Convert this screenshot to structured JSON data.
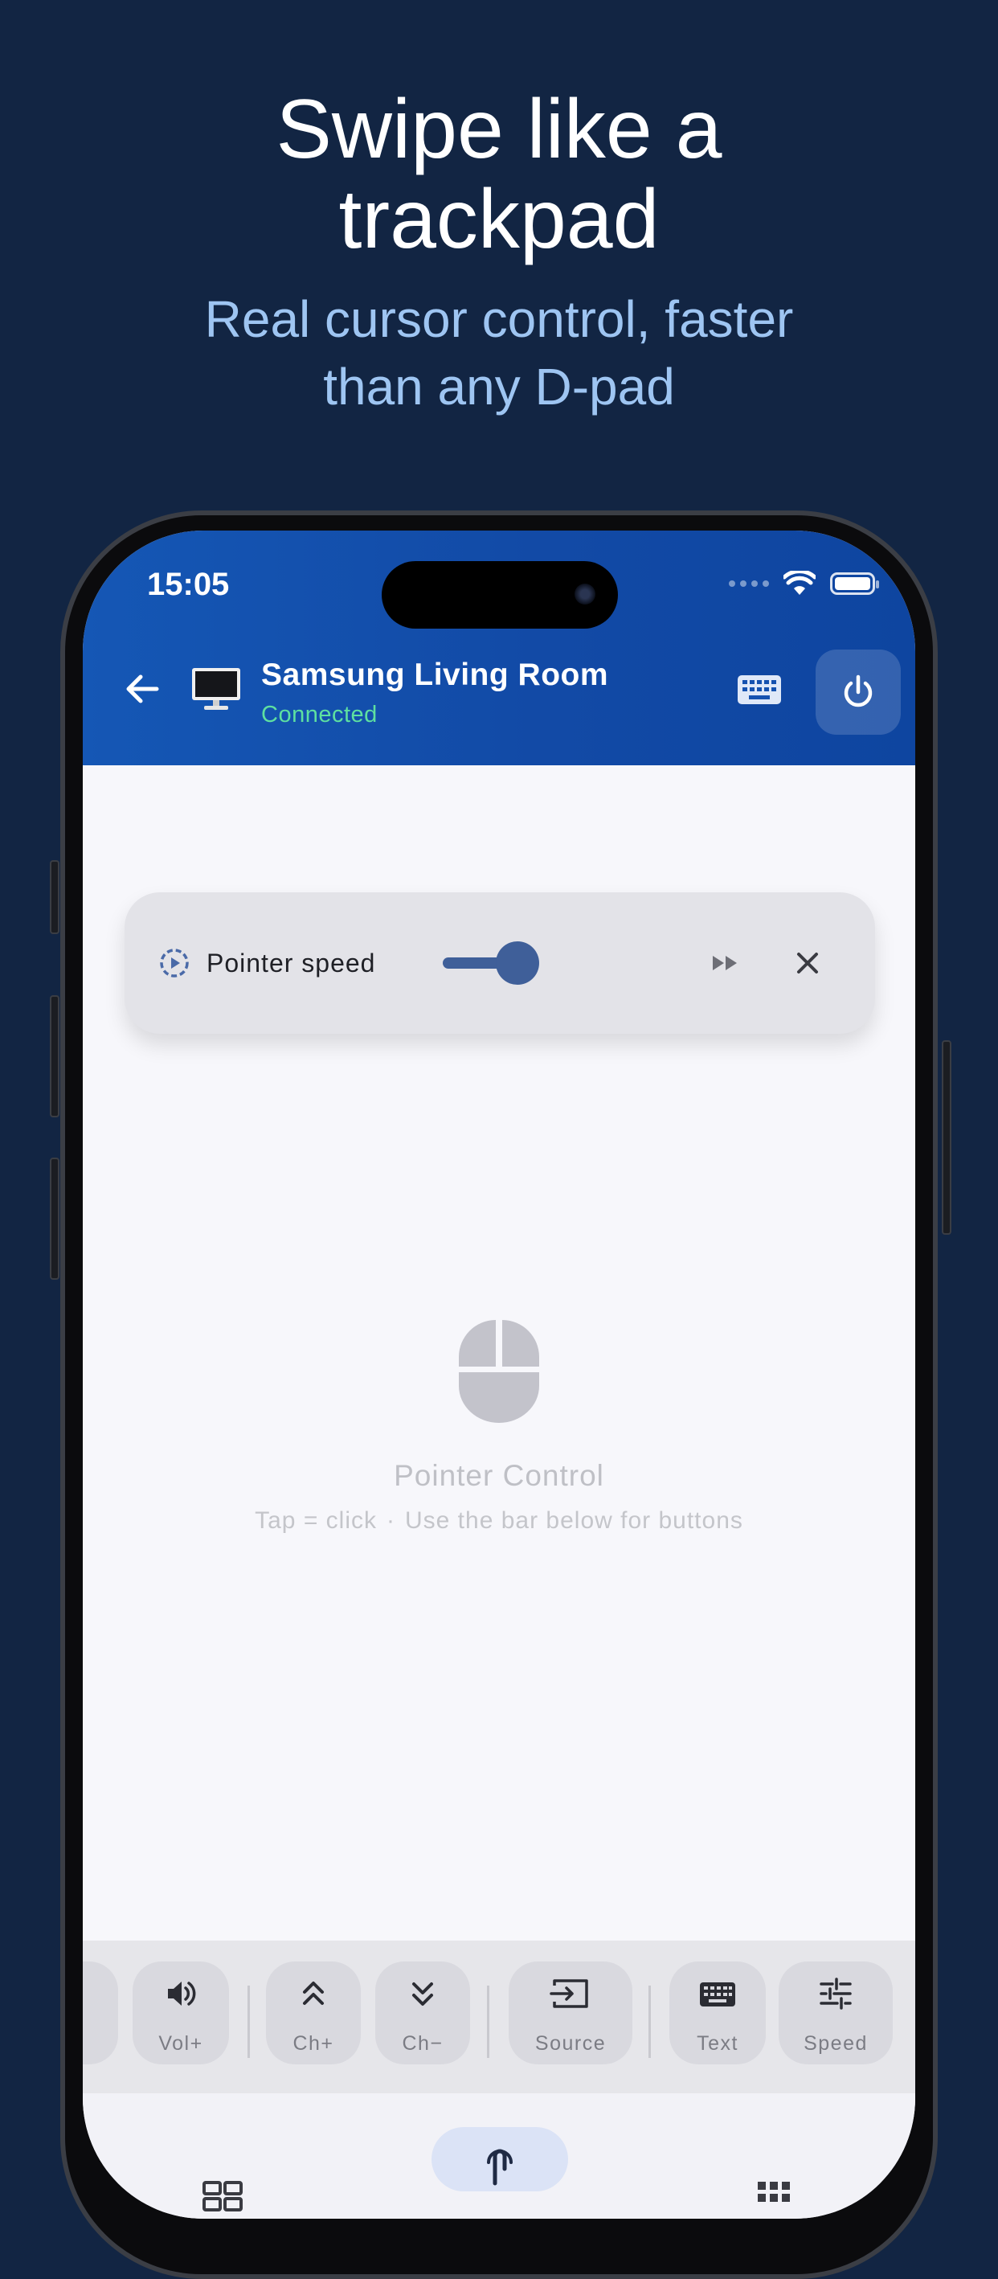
{
  "marketing": {
    "headline_line1": "Swipe like a",
    "headline_line2": "trackpad",
    "subline_line1": "Real cursor control, faster",
    "subline_line2": "than any D-pad"
  },
  "status_bar": {
    "time": "15:05"
  },
  "header": {
    "device_name": "Samsung Living Room",
    "device_status": "Connected"
  },
  "speed_panel": {
    "label": "Pointer speed",
    "level": 0.3
  },
  "pointer_area": {
    "title": "Pointer Control",
    "hint_left": "Tap = click",
    "hint_sep": "·",
    "hint_right": "Use the bar below for buttons"
  },
  "toolbar": {
    "items": [
      {
        "label": "Vol+",
        "icon": "volume-up-icon"
      },
      {
        "label": "Ch+",
        "icon": "chevron-double-up-icon"
      },
      {
        "label": "Ch−",
        "icon": "chevron-double-down-icon"
      },
      {
        "label": "Source",
        "icon": "input-source-icon"
      },
      {
        "label": "Text",
        "icon": "keyboard-icon"
      },
      {
        "label": "Speed",
        "icon": "sliders-icon"
      }
    ]
  },
  "colors": {
    "background": "#122543",
    "appbar": "#1557b5",
    "accent": "#3f5f99",
    "connected": "#5ee0a0"
  }
}
